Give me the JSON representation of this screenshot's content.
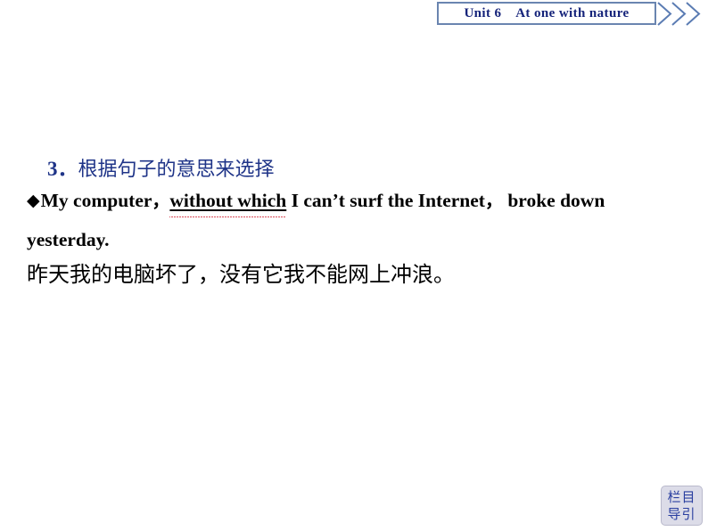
{
  "header": {
    "unit_label": "Unit 6",
    "unit_title": "At one with nature",
    "banner_text": "Unit 6    At one with nature",
    "border_color": "#6a85b0",
    "title_color": "#15237a",
    "chevron_color": "#5b7cb3",
    "chevron_icon": "double-chevron-right-icon",
    "chevron_count": 3
  },
  "main": {
    "section": {
      "number": "3．",
      "title": "根据句子的意思来选择",
      "color": "#1f3488"
    },
    "example": {
      "bullet": "◆",
      "english_parts": {
        "lead": "My computer",
        "comma1": "，",
        "underlined": "without which",
        "middle": " I can’t surf the Internet",
        "comma2": "，",
        "tail": " broke down yesterday."
      },
      "english_full": "◆My computer，without which I can’t surf the Internet，broke down yesterday.",
      "underline_color": "#000000",
      "spellcheck_underline_color": "#cc1122",
      "chinese_translation": "昨天我的电脑坏了，没有它我不能网上冲浪。"
    }
  },
  "footer": {
    "nav_button": {
      "line1": "栏目",
      "line2": "导引",
      "text_color": "#2a3fa0",
      "background_color": "#dcdce8"
    }
  }
}
